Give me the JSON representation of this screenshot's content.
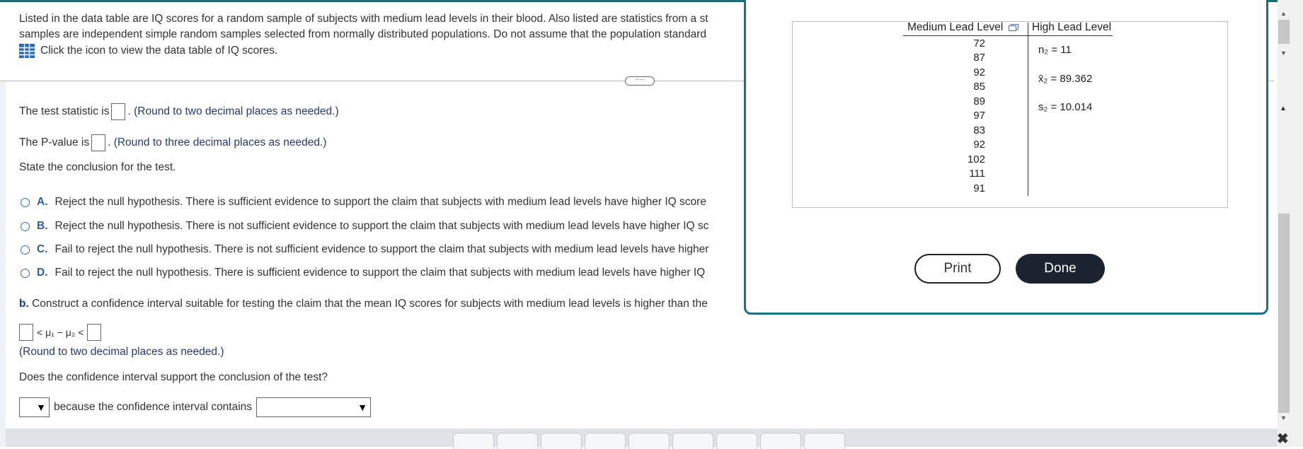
{
  "intro": {
    "line1": "Listed in the data table are IQ scores for a random sample of subjects with medium lead levels in their blood. Also listed are statistics from a st",
    "line2": "samples are independent simple random samples selected from normally distributed populations. Do not assume that the population standard",
    "icon_link": "Click the icon to view the data table of IQ scores."
  },
  "expander_label": "····",
  "test_stat": {
    "label": "The test statistic is",
    "hint": "(Round to two decimal places as needed.)"
  },
  "pvalue": {
    "label": "The P-value is",
    "hint": "(Round to three decimal places as needed.)"
  },
  "conclusion_prompt": "State the conclusion for the test.",
  "options": [
    {
      "letter": "A.",
      "text": "Reject the null hypothesis. There is sufficient evidence to support the claim that subjects with medium lead levels have higher IQ score"
    },
    {
      "letter": "B.",
      "text": "Reject the null hypothesis. There is not sufficient evidence to support the claim that subjects with medium lead levels have higher IQ sc"
    },
    {
      "letter": "C.",
      "text": "Fail to reject the null hypothesis. There is not sufficient evidence to support the claim that subjects with medium lead levels have higher"
    },
    {
      "letter": "D.",
      "text": "Fail to reject the null hypothesis. There is sufficient evidence to support the claim that subjects with medium lead levels have higher IQ"
    }
  ],
  "part_b": {
    "label": "b.",
    "text": "Construct a confidence interval suitable for testing the claim that the mean IQ scores for subjects with medium lead levels is higher than the",
    "ci_middle": "< μ₁ − μ₂ <",
    "hint": "(Round to two decimal places as needed.)",
    "support_question": "Does the confidence interval support the conclusion of the test?",
    "because_text": "because the confidence interval contains"
  },
  "modal": {
    "col1_header": "Medium Lead Level",
    "col2_header": "High Lead Level",
    "medium_values": [
      "72",
      "87",
      "92",
      "85",
      "89",
      "97",
      "83",
      "92",
      "102",
      "111",
      "91"
    ],
    "stats": [
      "n₂ = 11",
      "x̄₂ = 89.362",
      "s₂ = 10.014"
    ],
    "print_label": "Print",
    "done_label": "Done"
  }
}
